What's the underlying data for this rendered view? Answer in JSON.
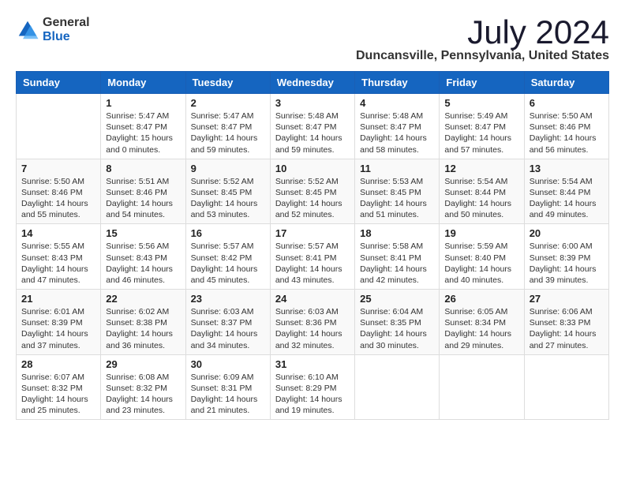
{
  "logo": {
    "general": "General",
    "blue": "Blue"
  },
  "title": "July 2024",
  "location": "Duncansville, Pennsylvania, United States",
  "weekdays": [
    "Sunday",
    "Monday",
    "Tuesday",
    "Wednesday",
    "Thursday",
    "Friday",
    "Saturday"
  ],
  "weeks": [
    [
      {
        "day": "",
        "info": ""
      },
      {
        "day": "1",
        "info": "Sunrise: 5:47 AM\nSunset: 8:47 PM\nDaylight: 15 hours\nand 0 minutes."
      },
      {
        "day": "2",
        "info": "Sunrise: 5:47 AM\nSunset: 8:47 PM\nDaylight: 14 hours\nand 59 minutes."
      },
      {
        "day": "3",
        "info": "Sunrise: 5:48 AM\nSunset: 8:47 PM\nDaylight: 14 hours\nand 59 minutes."
      },
      {
        "day": "4",
        "info": "Sunrise: 5:48 AM\nSunset: 8:47 PM\nDaylight: 14 hours\nand 58 minutes."
      },
      {
        "day": "5",
        "info": "Sunrise: 5:49 AM\nSunset: 8:47 PM\nDaylight: 14 hours\nand 57 minutes."
      },
      {
        "day": "6",
        "info": "Sunrise: 5:50 AM\nSunset: 8:46 PM\nDaylight: 14 hours\nand 56 minutes."
      }
    ],
    [
      {
        "day": "7",
        "info": "Sunrise: 5:50 AM\nSunset: 8:46 PM\nDaylight: 14 hours\nand 55 minutes."
      },
      {
        "day": "8",
        "info": "Sunrise: 5:51 AM\nSunset: 8:46 PM\nDaylight: 14 hours\nand 54 minutes."
      },
      {
        "day": "9",
        "info": "Sunrise: 5:52 AM\nSunset: 8:45 PM\nDaylight: 14 hours\nand 53 minutes."
      },
      {
        "day": "10",
        "info": "Sunrise: 5:52 AM\nSunset: 8:45 PM\nDaylight: 14 hours\nand 52 minutes."
      },
      {
        "day": "11",
        "info": "Sunrise: 5:53 AM\nSunset: 8:45 PM\nDaylight: 14 hours\nand 51 minutes."
      },
      {
        "day": "12",
        "info": "Sunrise: 5:54 AM\nSunset: 8:44 PM\nDaylight: 14 hours\nand 50 minutes."
      },
      {
        "day": "13",
        "info": "Sunrise: 5:54 AM\nSunset: 8:44 PM\nDaylight: 14 hours\nand 49 minutes."
      }
    ],
    [
      {
        "day": "14",
        "info": "Sunrise: 5:55 AM\nSunset: 8:43 PM\nDaylight: 14 hours\nand 47 minutes."
      },
      {
        "day": "15",
        "info": "Sunrise: 5:56 AM\nSunset: 8:43 PM\nDaylight: 14 hours\nand 46 minutes."
      },
      {
        "day": "16",
        "info": "Sunrise: 5:57 AM\nSunset: 8:42 PM\nDaylight: 14 hours\nand 45 minutes."
      },
      {
        "day": "17",
        "info": "Sunrise: 5:57 AM\nSunset: 8:41 PM\nDaylight: 14 hours\nand 43 minutes."
      },
      {
        "day": "18",
        "info": "Sunrise: 5:58 AM\nSunset: 8:41 PM\nDaylight: 14 hours\nand 42 minutes."
      },
      {
        "day": "19",
        "info": "Sunrise: 5:59 AM\nSunset: 8:40 PM\nDaylight: 14 hours\nand 40 minutes."
      },
      {
        "day": "20",
        "info": "Sunrise: 6:00 AM\nSunset: 8:39 PM\nDaylight: 14 hours\nand 39 minutes."
      }
    ],
    [
      {
        "day": "21",
        "info": "Sunrise: 6:01 AM\nSunset: 8:39 PM\nDaylight: 14 hours\nand 37 minutes."
      },
      {
        "day": "22",
        "info": "Sunrise: 6:02 AM\nSunset: 8:38 PM\nDaylight: 14 hours\nand 36 minutes."
      },
      {
        "day": "23",
        "info": "Sunrise: 6:03 AM\nSunset: 8:37 PM\nDaylight: 14 hours\nand 34 minutes."
      },
      {
        "day": "24",
        "info": "Sunrise: 6:03 AM\nSunset: 8:36 PM\nDaylight: 14 hours\nand 32 minutes."
      },
      {
        "day": "25",
        "info": "Sunrise: 6:04 AM\nSunset: 8:35 PM\nDaylight: 14 hours\nand 30 minutes."
      },
      {
        "day": "26",
        "info": "Sunrise: 6:05 AM\nSunset: 8:34 PM\nDaylight: 14 hours\nand 29 minutes."
      },
      {
        "day": "27",
        "info": "Sunrise: 6:06 AM\nSunset: 8:33 PM\nDaylight: 14 hours\nand 27 minutes."
      }
    ],
    [
      {
        "day": "28",
        "info": "Sunrise: 6:07 AM\nSunset: 8:32 PM\nDaylight: 14 hours\nand 25 minutes."
      },
      {
        "day": "29",
        "info": "Sunrise: 6:08 AM\nSunset: 8:32 PM\nDaylight: 14 hours\nand 23 minutes."
      },
      {
        "day": "30",
        "info": "Sunrise: 6:09 AM\nSunset: 8:31 PM\nDaylight: 14 hours\nand 21 minutes."
      },
      {
        "day": "31",
        "info": "Sunrise: 6:10 AM\nSunset: 8:29 PM\nDaylight: 14 hours\nand 19 minutes."
      },
      {
        "day": "",
        "info": ""
      },
      {
        "day": "",
        "info": ""
      },
      {
        "day": "",
        "info": ""
      }
    ]
  ]
}
